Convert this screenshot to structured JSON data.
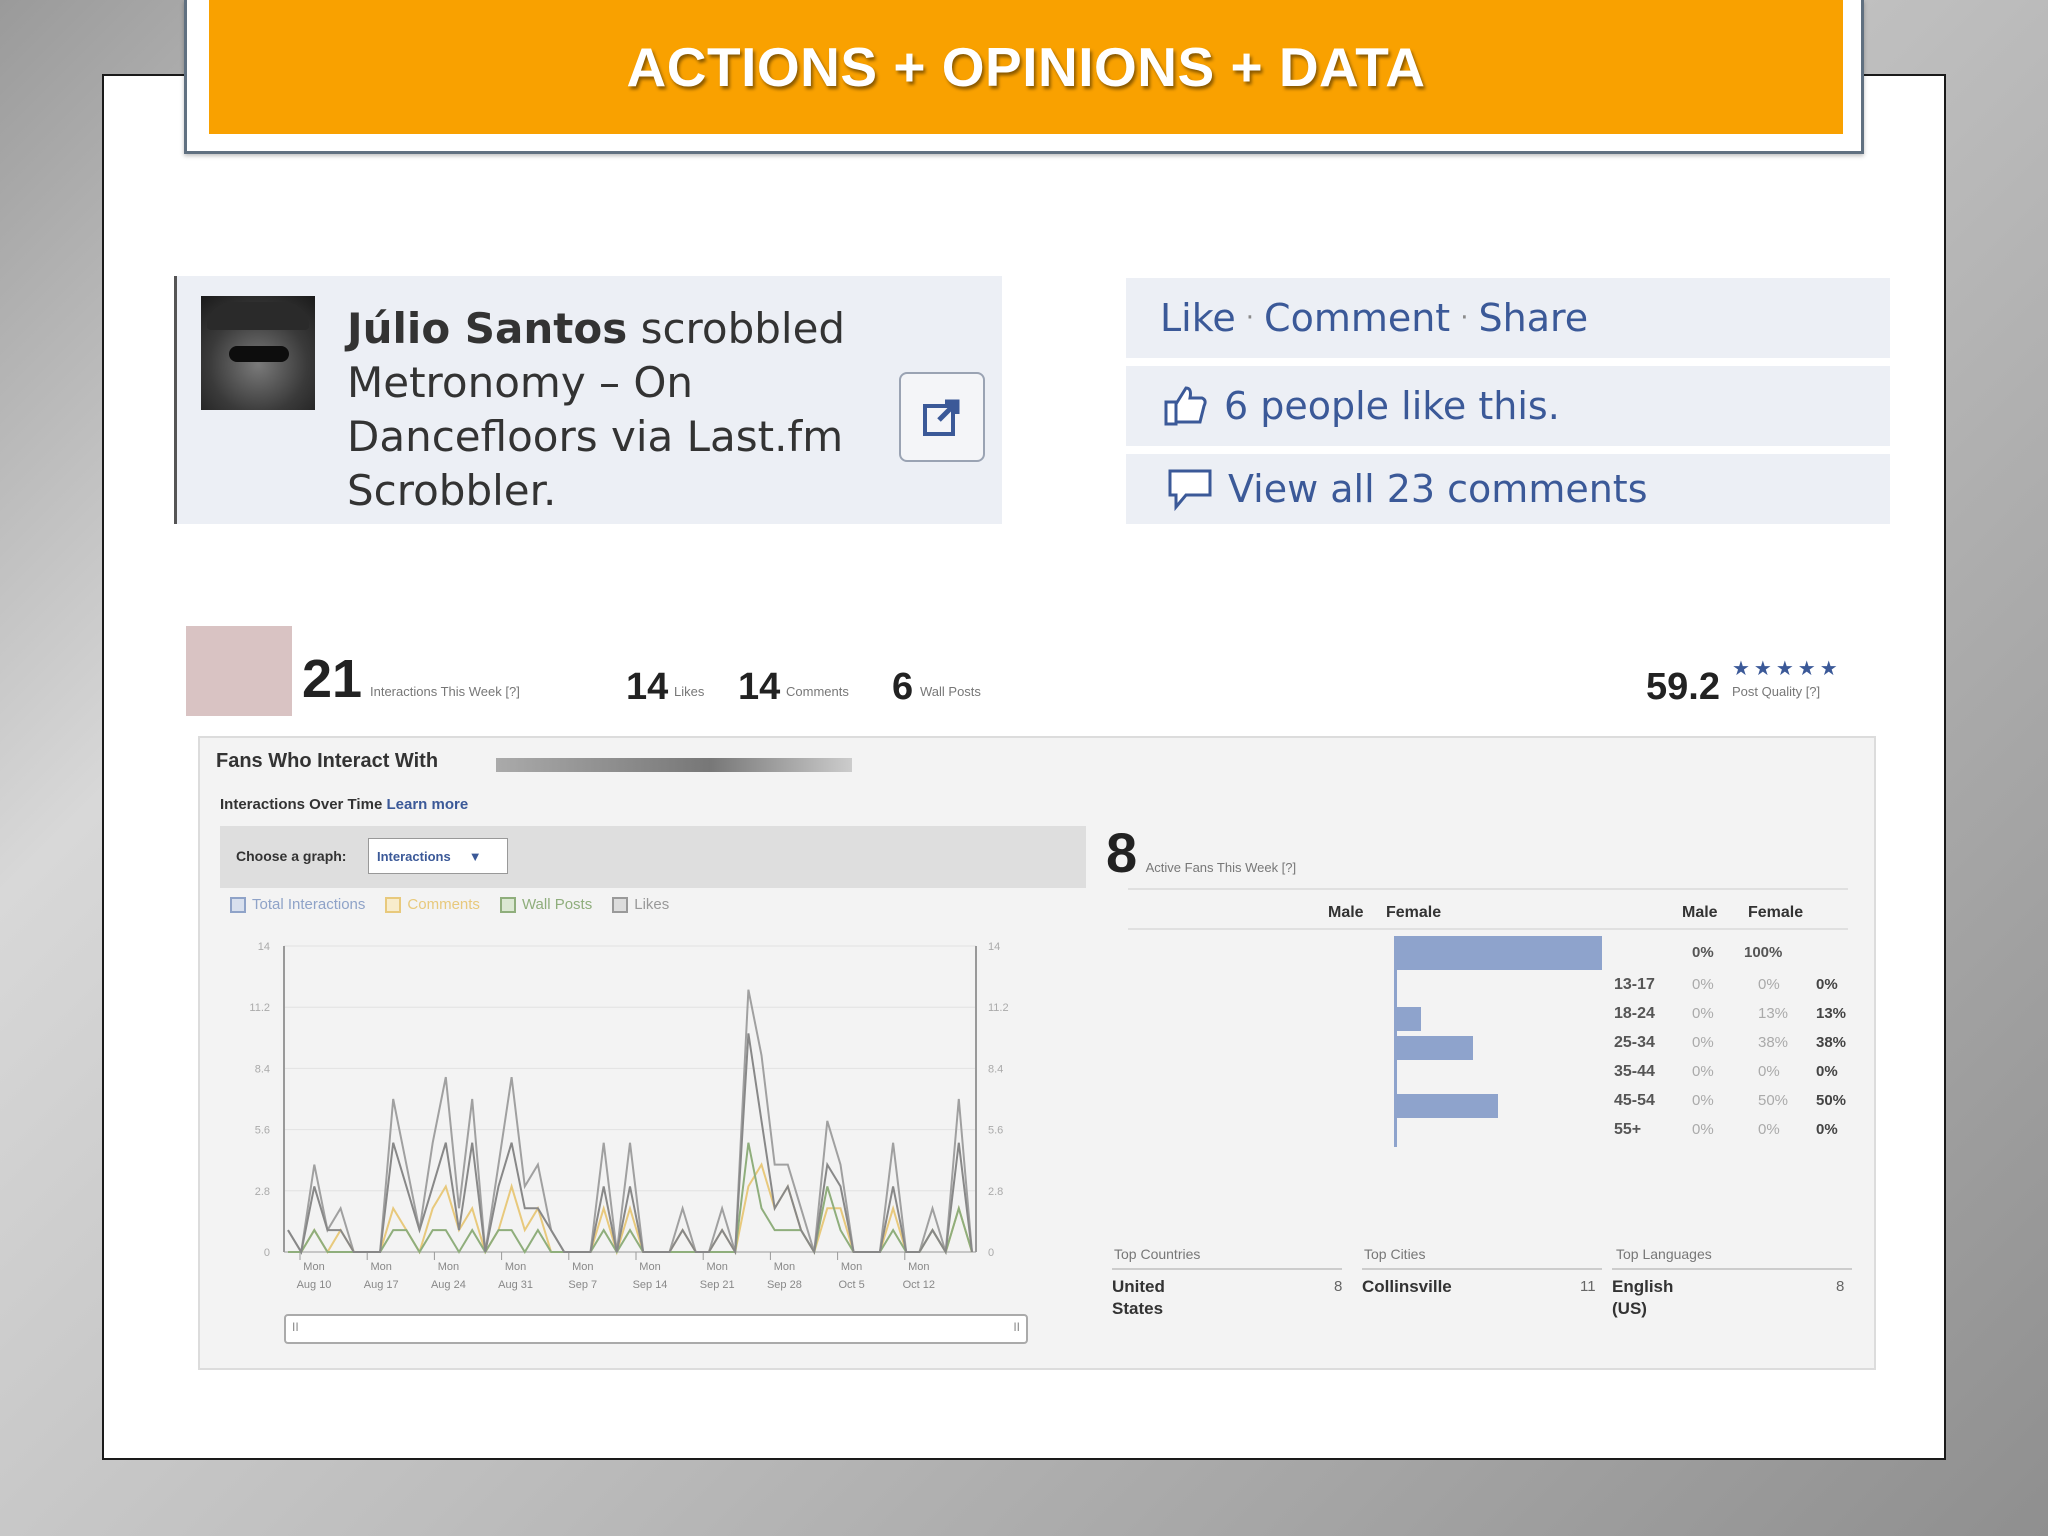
{
  "slide": {
    "title": "ACTIONS + OPINIONS + DATA"
  },
  "story": {
    "user": "Júlio Santos",
    "verb": "scrobbled",
    "line2": "Metronomy – On",
    "line3": "Dancefloors via Last.fm",
    "line4": "Scrobbler."
  },
  "actions": {
    "like": "Like",
    "comment": "Comment",
    "share": "Share",
    "sep": "·",
    "likes_text": "6 people like this.",
    "comments_text": "View all 23 comments"
  },
  "stats": {
    "interactions": "21",
    "interactions_label": "Interactions This Week [?]",
    "likes": "14",
    "likes_label": "Likes",
    "comments": "14",
    "comments_label": "Comments",
    "wall_posts": "6",
    "wall_posts_label": "Wall Posts",
    "post_quality": "59.2",
    "post_quality_label": "Post Quality [?]",
    "stars": "★★★★★"
  },
  "insights": {
    "title": "Fans Who Interact With",
    "subtitle": "Interactions Over Time",
    "learn_more": "Learn more",
    "choose_graph": "Choose a graph:",
    "graph_selected": "Interactions",
    "legend": [
      "Total Interactions",
      "Comments",
      "Wall Posts",
      "Likes"
    ],
    "active_fans": "8",
    "active_fans_label": "Active Fans This Week [?]",
    "male": "Male",
    "female": "Female",
    "male_total": "0%",
    "female_total": "100%",
    "age_groups": [
      {
        "age": "13-17",
        "male": "0%",
        "female": "0%",
        "total": "0%",
        "female_pct": 0
      },
      {
        "age": "18-24",
        "male": "0%",
        "female": "13%",
        "total": "13%",
        "female_pct": 13
      },
      {
        "age": "25-34",
        "male": "0%",
        "female": "38%",
        "total": "38%",
        "female_pct": 38
      },
      {
        "age": "35-44",
        "male": "0%",
        "female": "0%",
        "total": "0%",
        "female_pct": 0
      },
      {
        "age": "45-54",
        "male": "0%",
        "female": "50%",
        "total": "50%",
        "female_pct": 50
      },
      {
        "age": "55+",
        "male": "0%",
        "female": "0%",
        "total": "0%",
        "female_pct": 0
      }
    ],
    "top_countries_label": "Top Countries",
    "top_country": "United States",
    "top_country_count": "8",
    "top_cities_label": "Top Cities",
    "top_city": "Collinsville",
    "top_city_count": "11",
    "top_languages_label": "Top Languages",
    "top_language": "English (US)",
    "top_language_count": "8",
    "scroll_left": "II",
    "scroll_right": "II"
  },
  "chart_data": {
    "type": "line",
    "ylim": [
      0,
      14
    ],
    "y_ticks": [
      "0",
      "2.8",
      "5.6",
      "8.4",
      "11.2",
      "14"
    ],
    "x_ticks": [
      "Mon Aug 10",
      "Mon Aug 17",
      "Mon Aug 24",
      "Mon Aug 31",
      "Mon Sep 7",
      "Mon Sep 14",
      "Mon Sep 21",
      "Mon Sep 28",
      "Mon Oct 5",
      "Mon Oct 12"
    ],
    "series": [
      {
        "name": "Total Interactions",
        "color": "#a0a0a0",
        "values": [
          1,
          0,
          4,
          1,
          2,
          0,
          0,
          0,
          7,
          4,
          1,
          5,
          8,
          2,
          7,
          0,
          4,
          8,
          3,
          4,
          1,
          0,
          0,
          0,
          5,
          0,
          5,
          0,
          0,
          0,
          2,
          0,
          0,
          2,
          0,
          12,
          9,
          4,
          4,
          2,
          0,
          6,
          4,
          0,
          0,
          0,
          5,
          0,
          0,
          2,
          0,
          7,
          0
        ]
      },
      {
        "name": "Comments",
        "color": "#e8c97c",
        "values": [
          0,
          0,
          1,
          0,
          1,
          0,
          0,
          0,
          2,
          1,
          0,
          2,
          3,
          1,
          2,
          0,
          1,
          3,
          1,
          2,
          0,
          0,
          0,
          0,
          2,
          0,
          2,
          0,
          0,
          0,
          1,
          0,
          0,
          1,
          0,
          3,
          4,
          2,
          3,
          1,
          0,
          2,
          2,
          0,
          0,
          0,
          2,
          0,
          0,
          1,
          0,
          2,
          0
        ]
      },
      {
        "name": "Wall Posts",
        "color": "#8fae7c",
        "values": [
          0,
          0,
          1,
          0,
          0,
          0,
          0,
          0,
          1,
          1,
          0,
          1,
          1,
          0,
          1,
          0,
          1,
          1,
          0,
          1,
          0,
          0,
          0,
          0,
          1,
          0,
          1,
          0,
          0,
          0,
          0,
          0,
          0,
          0,
          0,
          5,
          2,
          1,
          1,
          1,
          0,
          3,
          1,
          0,
          0,
          0,
          1,
          0,
          0,
          1,
          0,
          2,
          0
        ]
      },
      {
        "name": "Likes",
        "color": "#888888",
        "values": [
          1,
          0,
          3,
          1,
          1,
          0,
          0,
          0,
          5,
          3,
          1,
          3,
          5,
          1,
          5,
          0,
          3,
          5,
          2,
          2,
          1,
          0,
          0,
          0,
          3,
          0,
          3,
          0,
          0,
          0,
          1,
          0,
          0,
          1,
          0,
          10,
          6,
          2,
          3,
          1,
          0,
          4,
          3,
          0,
          0,
          0,
          3,
          0,
          0,
          1,
          0,
          5,
          0
        ]
      }
    ]
  }
}
